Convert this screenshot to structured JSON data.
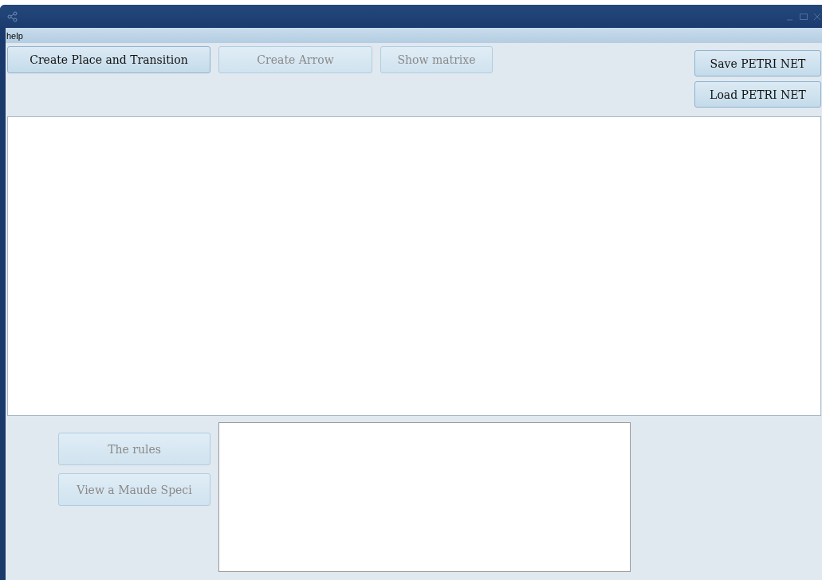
{
  "menu": [
    {
      "label": "help"
    }
  ],
  "toolbar": [
    {
      "label": "Create Place and Transition",
      "disabled": false
    },
    {
      "label": "Create Arrow",
      "disabled": true
    },
    {
      "label": "Show matrixe",
      "disabled": true
    }
  ],
  "file_buttons": [
    {
      "label": "Save PETRI NET",
      "disabled": false
    },
    {
      "label": "Load PETRI NET",
      "disabled": false
    }
  ],
  "side_buttons": [
    {
      "label": "The rules",
      "disabled": true
    },
    {
      "label": "View a Maude Speci",
      "disabled": true
    }
  ]
}
